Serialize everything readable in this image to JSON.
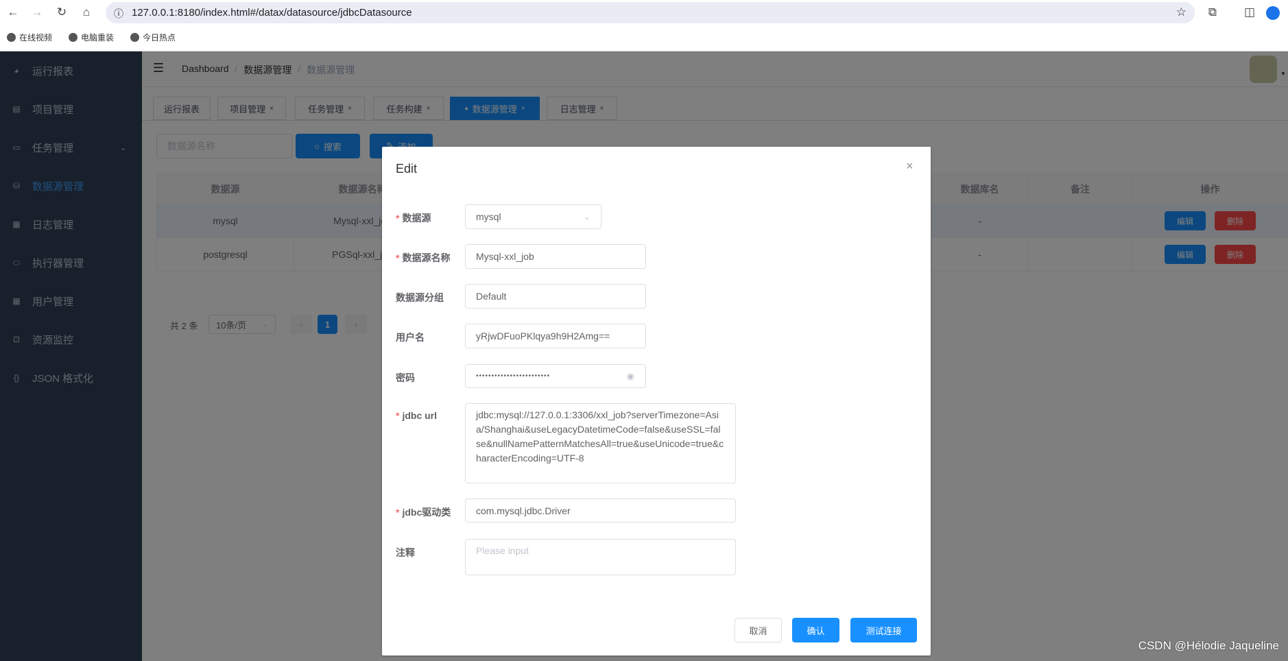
{
  "browser": {
    "url": "127.0.0.1:8180/index.html#/datax/datasource/jdbcDatasource",
    "bookmarks": [
      "在线视频",
      "电脑重装",
      "今日热点"
    ]
  },
  "sidebar": {
    "items": [
      {
        "label": "运行报表",
        "icon": "dashboard-icon"
      },
      {
        "label": "项目管理",
        "icon": "project-icon"
      },
      {
        "label": "任务管理",
        "icon": "monitor-icon",
        "expandable": true
      },
      {
        "label": "数据源管理",
        "icon": "database-icon",
        "active": true
      },
      {
        "label": "日志管理",
        "icon": "log-icon"
      },
      {
        "label": "执行器管理",
        "icon": "executor-icon"
      },
      {
        "label": "用户管理",
        "icon": "table-icon"
      },
      {
        "label": "资源监控",
        "icon": "battery-icon"
      },
      {
        "label": "JSON 格式化",
        "icon": "braces-icon"
      }
    ]
  },
  "breadcrumb": [
    "Dashboard",
    "数据源管理",
    "数据源管理"
  ],
  "tags": [
    {
      "label": "运行报表",
      "closable": false
    },
    {
      "label": "项目管理",
      "closable": true
    },
    {
      "label": "任务管理",
      "closable": true
    },
    {
      "label": "任务构建",
      "closable": true
    },
    {
      "label": "数据源管理",
      "closable": true,
      "active": true
    },
    {
      "label": "日志管理",
      "closable": true
    }
  ],
  "toolbar": {
    "search_placeholder": "数据源名称",
    "search_label": "搜索",
    "add_label": "添加"
  },
  "table": {
    "headers": [
      "数据源",
      "数据源名称",
      "数据库名",
      "备注",
      "操作"
    ],
    "rows": [
      {
        "datasource": "mysql",
        "name": "Mysql-xxl_job",
        "db": "-",
        "remark": ""
      },
      {
        "datasource": "postgresql",
        "name": "PGSql-xxl_job",
        "db": "-",
        "remark": ""
      }
    ],
    "edit_label": "编辑",
    "delete_label": "删除"
  },
  "pagination": {
    "total": "共 2 条",
    "page_size": "10条/页",
    "current": "1"
  },
  "modal": {
    "title": "Edit",
    "fields": {
      "datasource": {
        "label": "数据源",
        "value": "mysql",
        "required": true
      },
      "name": {
        "label": "数据源名称",
        "value": "Mysql-xxl_job",
        "required": true
      },
      "group": {
        "label": "数据源分组",
        "value": "Default"
      },
      "username": {
        "label": "用户名",
        "value": "yRjwDFuoPKlqya9h9H2Amg=="
      },
      "password": {
        "label": "密码",
        "value": "••••••••••••••••••••••••"
      },
      "jdbc_url": {
        "label": "jdbc url",
        "value": "jdbc:mysql://127.0.0.1:3306/xxl_job?serverTimezone=Asia/Shanghai&useLegacyDatetimeCode=false&useSSL=false&nullNamePatternMatchesAll=true&useUnicode=true&characterEncoding=UTF-8",
        "required": true
      },
      "driver": {
        "label": "jdbc驱动类",
        "value": "com.mysql.jdbc.Driver",
        "required": true
      },
      "comment": {
        "label": "注释",
        "placeholder": "Please input"
      }
    },
    "cancel_label": "取消",
    "confirm_label": "确认",
    "test_label": "测试连接"
  },
  "watermark": "CSDN @Hélodie Jaqueline",
  "colors": {
    "primary": "#1890ff",
    "danger": "#ff4949",
    "sidebar": "#304156"
  }
}
